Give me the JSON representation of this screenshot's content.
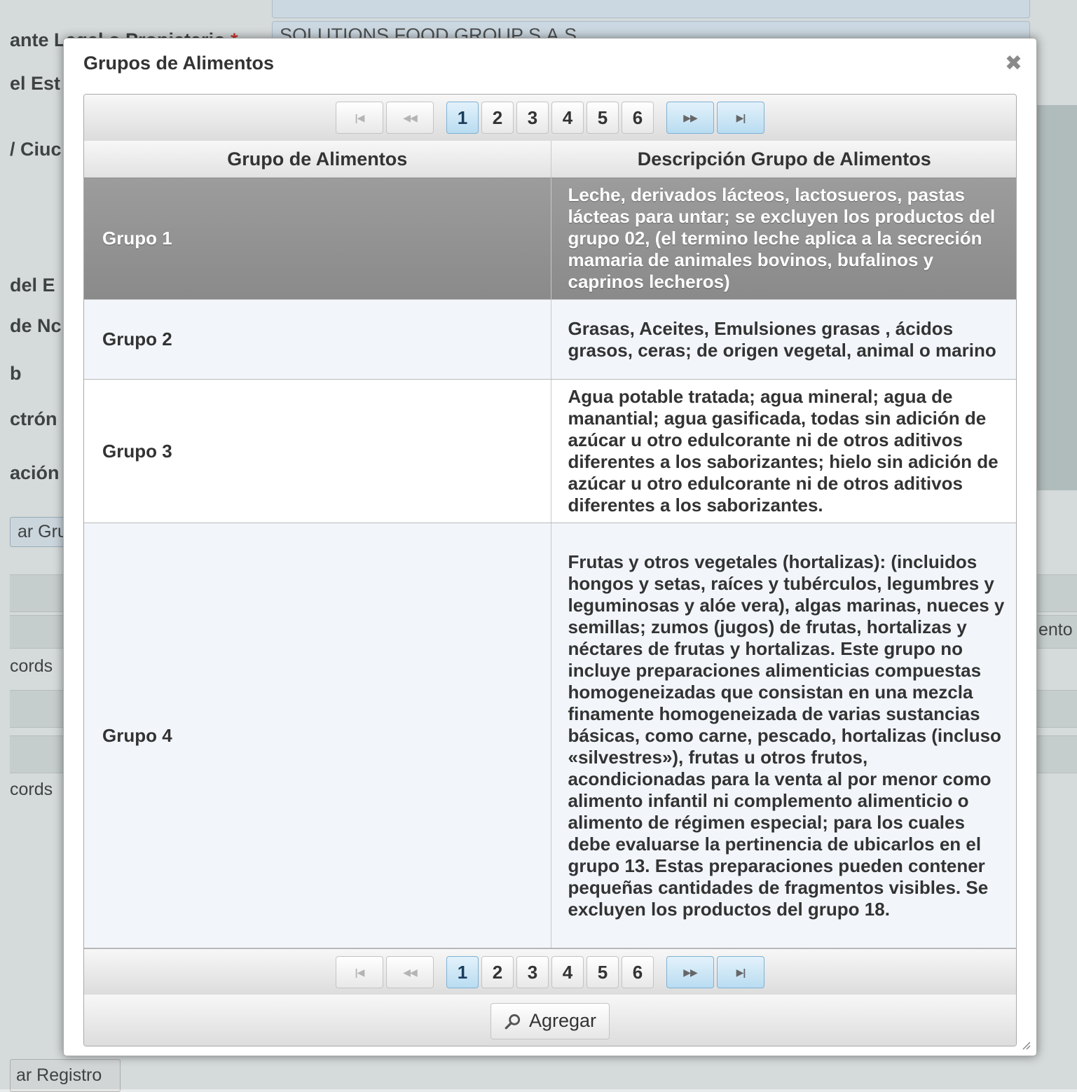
{
  "background": {
    "labels": [
      "ante Legal o Propietario",
      "el Est",
      "/ Ciuc",
      "del E",
      "de Nc",
      "b",
      "ctrón",
      "ación"
    ],
    "required_mark": "*",
    "rep_value": "SOLUTIONS FOOD GROUP S.A.S",
    "agregar_grupo_partial": "ar Gru",
    "records_label_1": "cords",
    "records_label_2": "cords",
    "right_partial": "ento",
    "guardar_registro_partial": "ar Registro"
  },
  "dialog": {
    "title": "Grupos de Alimentos",
    "close_glyph": "✖",
    "paginator": {
      "first": "|◀",
      "prev": "◀◀",
      "pages": [
        "1",
        "2",
        "3",
        "4",
        "5",
        "6"
      ],
      "current_page": "1",
      "next": "▶▶",
      "last": "▶|"
    },
    "table": {
      "headers": [
        "Grupo de Alimentos",
        "Descripción Grupo de Alimentos"
      ],
      "rows": [
        {
          "grupo": "Grupo 1",
          "descripcion": "Leche, derivados lácteos, lactosueros, pastas lácteas para untar; se excluyen los productos del grupo 02, (el termino leche aplica a la secreción mamaria de animales bovinos, bufalinos y caprinos lecheros)"
        },
        {
          "grupo": "Grupo 2",
          "descripcion": "Grasas, Aceites, Emulsiones grasas , ácidos grasos, ceras; de origen vegetal, animal o marino"
        },
        {
          "grupo": "Grupo 3",
          "descripcion": "Agua potable tratada; agua mineral; agua de manantial; agua gasificada, todas sin adición de azúcar u otro edulcorante ni de otros aditivos diferentes a los saborizantes; hielo sin adición de azúcar u otro edulcorante ni de otros aditivos diferentes a los saborizantes."
        },
        {
          "grupo": "Grupo 4",
          "descripcion": "Frutas y otros vegetales (hortalizas): (incluidos hongos y setas, raíces y tubérculos, legumbres y leguminosas y alóe vera), algas marinas, nueces y semillas; zumos (jugos) de frutas, hortalizas y néctares de frutas y hortalizas. Este grupo no incluye preparaciones alimenticias compuestas homogeneizadas que consistan en una mezcla finamente homogeneizada de varias sustancias básicas, como carne, pescado, hortalizas (incluso «silvestres»), frutas u otros frutos, acondicionadas para la venta al por menor como alimento infantil ni complemento alimenticio o alimento de régimen especial; para los cuales debe evaluarse la pertinencia de ubicarlos en el grupo 13. Estas preparaciones pueden contener pequeñas cantidades de fragmentos visibles. Se excluyen los productos del grupo 18."
        }
      ]
    },
    "agregar_label": "Agregar"
  },
  "colors": {
    "selected_row": "#8f8f8f",
    "active_page": "#b9dcf1",
    "alt_row": "#f2f6fb"
  }
}
